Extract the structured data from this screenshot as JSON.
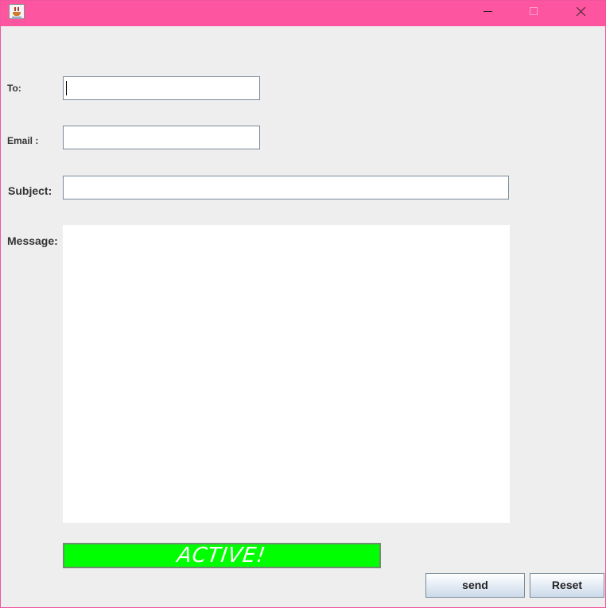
{
  "window": {
    "title": "",
    "titlebar_color": "#fd55a0",
    "app_icon": "java-cup-icon",
    "controls": [
      "minimize-icon",
      "maximize-icon",
      "close-icon"
    ]
  },
  "form": {
    "to_label": "To:",
    "to_value": "",
    "email_label": "Email :",
    "email_value": "",
    "subject_label": "Subject:",
    "subject_value": "",
    "message_label": "Message:",
    "message_value": ""
  },
  "status": {
    "text": "ACTIVE!",
    "color": "#00ff00"
  },
  "buttons": {
    "send_label": "send",
    "reset_label": "Reset"
  }
}
